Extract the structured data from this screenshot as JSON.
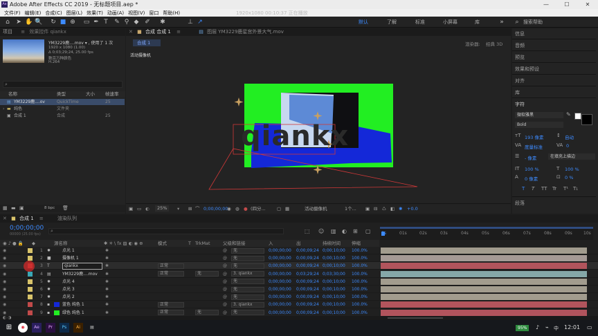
{
  "window": {
    "title": "Adobe After Effects CC 2019 - 无标题项目.aep *",
    "watermark": "1920x1080  00:10:37  正在播放"
  },
  "menu": [
    "文件(F)",
    "编辑(E)",
    "合成(C)",
    "图层(L)",
    "效果(T)",
    "动画(A)",
    "视图(V)",
    "窗口",
    "帮助(H)"
  ],
  "workspaces": [
    "默认",
    "了解",
    "标准",
    "小屏幕",
    "库"
  ],
  "search_help": "搜索帮助",
  "project": {
    "tab_label": "项目",
    "effects_tab": "效果控件 qiankx",
    "thumb_name": "YM3229鹿....mov ▾ , 使用了 1 次",
    "thumb_info": [
      "1920 x 1080 (1.00)",
      "Δ 0;03;29;24, 25.00 fps",
      "数百万种颜色",
      "H.264"
    ],
    "columns": [
      "名称",
      "类型",
      "大小",
      "帧速率"
    ],
    "items": [
      {
        "name": "YM3229鹿....ov",
        "type": "QuickTime",
        "size": "",
        "fps": "25"
      },
      {
        "name": "纯色",
        "type": "文件夹",
        "size": "",
        "fps": ""
      },
      {
        "name": "合成 1",
        "type": "合成",
        "size": "",
        "fps": "25"
      }
    ],
    "bpc": "8 bpc"
  },
  "comp_viewer": {
    "tab_label": "合成 合成 1",
    "layer_tab": "图层 YM3229鹿星宫外景大气.mov",
    "sub_tab": "合成 1",
    "renderer_label": "渲染器:",
    "renderer_value": "经典 3D",
    "camera_label": "活动摄像机",
    "overlay_text": "qiankx",
    "zoom": "25%",
    "timecode": "0;00;00;00",
    "resolution": "(四分...",
    "camera_view": "活动摄像机",
    "views": "1个...",
    "exposure": "+0.0",
    "screen_bg": "#22ee22",
    "plane_color": "#1428d8"
  },
  "right_panel": {
    "items": [
      "信息",
      "音频",
      "预览",
      "效果和预设",
      "对齐",
      "库",
      "字符"
    ],
    "font_name": "微软雅黑",
    "font_style": "Bold",
    "font_size": "193 像素",
    "leading": "自动",
    "tracking_label": "度量标准",
    "tracking_value": "0",
    "stroke_width": "- 像素",
    "stroke_type": "在填充上描边",
    "scale_v": "100 %",
    "scale_h": "100 %",
    "baseline": "0 像素",
    "tsume": "0 %",
    "style_buttons": [
      "T",
      "T",
      "TT",
      "Tr",
      "T¹",
      "T₁"
    ],
    "paragraph_label": "段落"
  },
  "timeline": {
    "tab_label": "合成 1",
    "queue_tab": "渲染队列",
    "timecode": "0;00;00;00",
    "fps_info": "00000 (25.00 fps)",
    "search_placeholder": "",
    "columns": [
      "源名称",
      "模式",
      "T",
      "TrkMat",
      "父级和链接",
      "入",
      "出",
      "持续时间",
      "伸缩"
    ],
    "ruler": [
      "0s",
      "01s",
      "02s",
      "03s",
      "04s",
      "05s",
      "06s",
      "07s",
      "08s",
      "09s",
      "10s"
    ],
    "layers": [
      {
        "num": "1",
        "name": "点光 1",
        "color": "#d8c36a",
        "icon": "light-icon",
        "mode": "",
        "trk": "",
        "parent": "无",
        "in": "0;00;00;00",
        "out": "0;00;09;24",
        "dur": "0;00;10;00",
        "stretch": "100.0%",
        "bar": "#a29c8e"
      },
      {
        "num": "2",
        "name": "摄像机 1",
        "color": "#d8c36a",
        "icon": "camera-icon",
        "mode": "",
        "trk": "",
        "parent": "无",
        "in": "0;00;00;00",
        "out": "0;00;09;24",
        "dur": "0;00;10;00",
        "stretch": "100.0%",
        "bar": "#a59a95"
      },
      {
        "num": "3",
        "name": "qiankx",
        "color": "#c24a4a",
        "icon": "text-icon",
        "mode": "正常",
        "trk": "",
        "parent": "无",
        "in": "0;00;00;00",
        "out": "0;00;09;24",
        "dur": "0;00;10;00",
        "stretch": "100.0%",
        "bar": "#b2545c",
        "selected": true
      },
      {
        "num": "4",
        "name": "YM3229鹿....mov",
        "color": "#3aa7b5",
        "icon": "footage-icon",
        "mode": "正常",
        "trk": "无",
        "parent": "3. qiankx",
        "in": "0;00;00;00",
        "out": "0;03;29;24",
        "dur": "0;03;30;00",
        "stretch": "100.0%",
        "bar": "#85a8a8"
      },
      {
        "num": "5",
        "name": "点光 4",
        "color": "#d8c36a",
        "icon": "light-icon",
        "mode": "",
        "trk": "",
        "parent": "无",
        "in": "0;00;00;00",
        "out": "0;00;09;24",
        "dur": "0;00;10;00",
        "stretch": "100.0%",
        "bar": "#a29c8e"
      },
      {
        "num": "6",
        "name": "点光 3",
        "color": "#d8c36a",
        "icon": "light-icon",
        "mode": "",
        "trk": "",
        "parent": "无",
        "in": "0;00;00;00",
        "out": "0;00;09;24",
        "dur": "0;00;10;00",
        "stretch": "100.0%",
        "bar": "#a29c8e"
      },
      {
        "num": "7",
        "name": "点光 2",
        "color": "#d8c36a",
        "icon": "light-icon",
        "mode": "",
        "trk": "",
        "parent": "无",
        "in": "0;00;00;00",
        "out": "0;00;09;24",
        "dur": "0;00;10;00",
        "stretch": "100.0%",
        "bar": "#a29c8e"
      },
      {
        "num": "8",
        "name": "蓝色 纯色 1",
        "color": "#c24a4a",
        "icon": "solid-icon",
        "mode": "正常",
        "trk": "",
        "parent": "3. qiankx",
        "in": "0;00;00;00",
        "out": "0;00;09;24",
        "dur": "0;00;10;00",
        "stretch": "100.0%",
        "bar": "#b2545c",
        "swatch": "#1428d8"
      },
      {
        "num": "9",
        "name": "绿色 纯色 1",
        "color": "#c24a4a",
        "icon": "solid-icon",
        "mode": "正常",
        "trk": "无",
        "parent": "无",
        "in": "0;00;00;00",
        "out": "0;00;09;24",
        "dur": "0;00;10;00",
        "stretch": "100.0%",
        "bar": "#b2545c",
        "swatch": "#22ee22"
      }
    ],
    "footer": "切换开关/模式"
  },
  "taskbar": {
    "battery": "95%",
    "ime": "中",
    "time": "12:01",
    "apps": [
      "Ae",
      "Pr",
      "Ps",
      "Ai"
    ]
  }
}
